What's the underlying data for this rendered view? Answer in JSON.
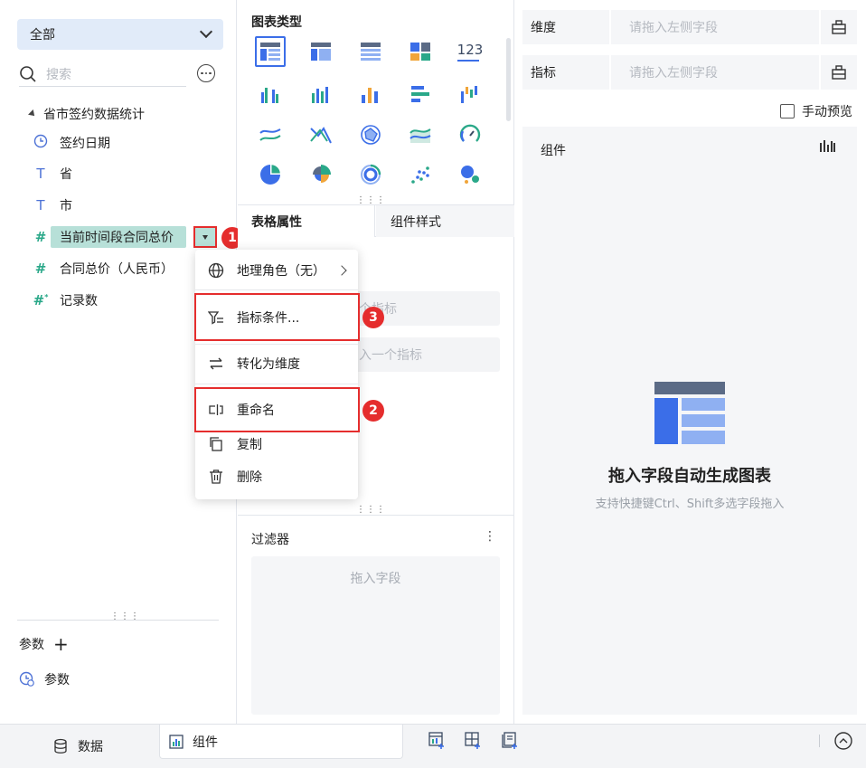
{
  "left": {
    "scope": "全部",
    "search_placeholder": "搜索",
    "tree_root": "省市签约数据统计",
    "fields": [
      {
        "label": "签约日期",
        "icon": "clock-icon"
      },
      {
        "label": "省",
        "icon": "text-type-icon"
      },
      {
        "label": "市",
        "icon": "text-type-icon"
      },
      {
        "label": "当前时间段合同总价",
        "icon": "number-type-icon"
      },
      {
        "label": "合同总价（人民币）",
        "icon": "number-type-icon"
      },
      {
        "label": "记录数",
        "icon": "count-type-icon"
      }
    ],
    "params_header": "参数",
    "params_item": "参数"
  },
  "middle": {
    "chart_type_title": "图表类型",
    "chart_types": [
      "table",
      "grouped-table",
      "detail-table",
      "treemap-table",
      "kpi-123",
      "grouped-column",
      "column",
      "stacked-column",
      "bar",
      "waterfall",
      "line",
      "radar-line",
      "radar",
      "area",
      "gauge",
      "pie",
      "rose",
      "ring",
      "scatter",
      "bubble"
    ],
    "kpi_text": "123",
    "tabs": [
      "表格属性",
      "组件样式"
    ],
    "drop_hint_1": "个指标",
    "drop_hint_2": "入一个指标",
    "filter_title": "过滤器",
    "filter_hint": "拖入字段"
  },
  "right": {
    "dimension_label": "维度",
    "dimension_placeholder": "请拖入左侧字段",
    "measure_label": "指标",
    "measure_placeholder": "请拖入左侧字段",
    "manual_preview": "手动预览",
    "canvas_title": "组件",
    "empty_title": "拖入字段自动生成图表",
    "empty_sub": "支持快捷键Ctrl、Shift多选字段拖入"
  },
  "menu": {
    "items": [
      "地理角色（无）",
      "指标条件...",
      "转化为维度",
      "重命名",
      "复制",
      "删除"
    ]
  },
  "badges": [
    "1",
    "2",
    "3"
  ],
  "bottom": {
    "tab_data": "数据",
    "tab_component": "组件"
  },
  "colors": {
    "accent": "#3b6ee8",
    "selected_field_bg": "#b7e0d8",
    "highlight_red": "#e52d2d",
    "scope_bg": "#e1ebf9"
  }
}
